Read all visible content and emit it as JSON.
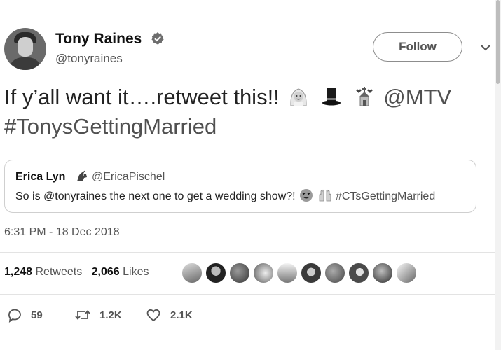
{
  "author": {
    "name": "Tony Raines",
    "handle": "@tonyraines",
    "verified_icon": "verified-badge-icon"
  },
  "header": {
    "follow_label": "Follow",
    "menu_icon": "chevron-down-icon"
  },
  "tweet": {
    "text_pre": "If y’all want it….retweet this!! ",
    "emojis": [
      "bride-with-veil-icon",
      "top-hat-icon",
      "wedding-chapel-icon"
    ],
    "mention": "@MTV",
    "hashtag": "#TonysGettingMarried"
  },
  "quoted_tweet": {
    "name": "Erica Lyn",
    "name_icon": "unicorn-icon",
    "handle": "@EricaPischel",
    "text_pre": "So is @tonyraines the next one to get a wedding show?! ",
    "emojis": [
      "heart-eyes-icon",
      "raised-hands-icon"
    ],
    "hashtag": "#CTsGettingMarried"
  },
  "timestamp": "6:31 PM - 18 Dec 2018",
  "stats": {
    "retweets_count": "1,248",
    "retweets_label": "Retweets",
    "likes_count": "2,066",
    "likes_label": "Likes"
  },
  "actions": {
    "replies": "59",
    "retweets": "1.2K",
    "likes": "2.1K"
  },
  "colors": {
    "text": "#111111",
    "muted": "#555555",
    "border": "#cfcfcf"
  }
}
